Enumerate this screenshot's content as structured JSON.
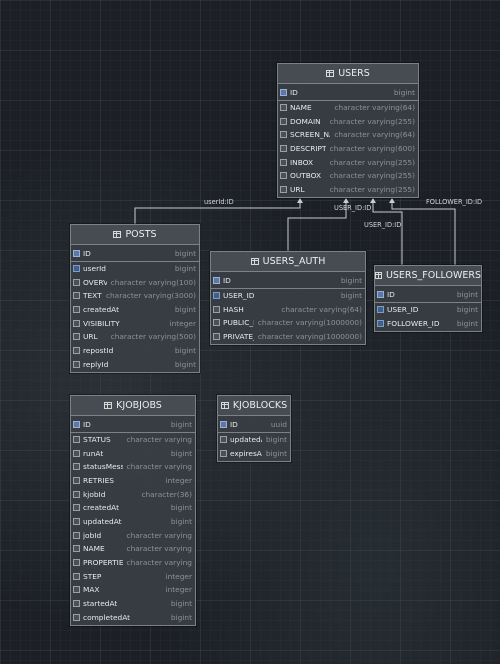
{
  "entities": {
    "users": {
      "name": "USERS",
      "icon": "table-icon",
      "columns": [
        {
          "name": "ID",
          "type": "bigint",
          "icon": "primary-key-icon"
        },
        {
          "name": "NAME",
          "type": "character varying(64)",
          "icon": "column-icon"
        },
        {
          "name": "DOMAIN",
          "type": "character varying(255)",
          "icon": "column-icon"
        },
        {
          "name": "SCREEN_NAME",
          "type": "character varying(64)",
          "icon": "column-icon"
        },
        {
          "name": "DESCRIPTION",
          "type": "character varying(600)",
          "icon": "column-icon"
        },
        {
          "name": "INBOX",
          "type": "character varying(255)",
          "icon": "column-icon"
        },
        {
          "name": "OUTBOX",
          "type": "character varying(255)",
          "icon": "column-icon"
        },
        {
          "name": "URL",
          "type": "character varying(255)",
          "icon": "column-icon"
        }
      ]
    },
    "posts": {
      "name": "POSTS",
      "icon": "table-icon",
      "columns": [
        {
          "name": "ID",
          "type": "bigint",
          "icon": "primary-key-icon"
        },
        {
          "name": "userId",
          "type": "bigint",
          "icon": "foreign-key-icon"
        },
        {
          "name": "OVERVIEW",
          "type": "character varying(100)",
          "icon": "column-icon"
        },
        {
          "name": "TEXT",
          "type": "character varying(3000)",
          "icon": "column-icon"
        },
        {
          "name": "createdAt",
          "type": "bigint",
          "icon": "column-icon"
        },
        {
          "name": "VISIBILITY",
          "type": "integer",
          "icon": "column-icon"
        },
        {
          "name": "URL",
          "type": "character varying(500)",
          "icon": "column-icon"
        },
        {
          "name": "repostId",
          "type": "bigint",
          "icon": "column-icon"
        },
        {
          "name": "replyId",
          "type": "bigint",
          "icon": "column-icon"
        }
      ]
    },
    "users_auth": {
      "name": "USERS_AUTH",
      "icon": "table-icon",
      "columns": [
        {
          "name": "ID",
          "type": "bigint",
          "icon": "primary-key-icon"
        },
        {
          "name": "USER_ID",
          "type": "bigint",
          "icon": "foreign-key-icon"
        },
        {
          "name": "HASH",
          "type": "character varying(64)",
          "icon": "column-icon"
        },
        {
          "name": "PUBLIC_KEY",
          "type": "character varying(1000000)",
          "icon": "column-icon"
        },
        {
          "name": "PRIVATE_KEY",
          "type": "character varying(1000000)",
          "icon": "column-icon"
        }
      ]
    },
    "users_followers": {
      "name": "USERS_FOLLOWERS",
      "icon": "table-icon",
      "columns": [
        {
          "name": "ID",
          "type": "bigint",
          "icon": "primary-key-icon"
        },
        {
          "name": "USER_ID",
          "type": "bigint",
          "icon": "foreign-key-icon"
        },
        {
          "name": "FOLLOWER_ID",
          "type": "bigint",
          "icon": "foreign-key-icon"
        }
      ]
    },
    "kjobjobs": {
      "name": "KJOBJOBS",
      "icon": "table-icon",
      "columns": [
        {
          "name": "ID",
          "type": "bigint",
          "icon": "primary-key-icon"
        },
        {
          "name": "STATUS",
          "type": "character varying",
          "icon": "column-icon"
        },
        {
          "name": "runAt",
          "type": "bigint",
          "icon": "column-icon"
        },
        {
          "name": "statusMessage",
          "type": "character varying",
          "icon": "column-icon"
        },
        {
          "name": "RETRIES",
          "type": "integer",
          "icon": "column-icon"
        },
        {
          "name": "kjobId",
          "type": "character(36)",
          "icon": "column-icon"
        },
        {
          "name": "createdAt",
          "type": "bigint",
          "icon": "column-icon"
        },
        {
          "name": "updatedAt",
          "type": "bigint",
          "icon": "column-icon"
        },
        {
          "name": "jobId",
          "type": "character varying",
          "icon": "column-icon"
        },
        {
          "name": "NAME",
          "type": "character varying",
          "icon": "column-icon"
        },
        {
          "name": "PROPERTIES",
          "type": "character varying",
          "icon": "column-icon"
        },
        {
          "name": "STEP",
          "type": "integer",
          "icon": "column-icon"
        },
        {
          "name": "MAX",
          "type": "integer",
          "icon": "column-icon"
        },
        {
          "name": "startedAt",
          "type": "bigint",
          "icon": "column-icon"
        },
        {
          "name": "completedAt",
          "type": "bigint",
          "icon": "column-icon"
        }
      ]
    },
    "kjoblocks": {
      "name": "KJOBLOCKS",
      "icon": "table-icon",
      "columns": [
        {
          "name": "ID",
          "type": "uuid",
          "icon": "primary-key-icon"
        },
        {
          "name": "updatedAt",
          "type": "bigint",
          "icon": "column-icon"
        },
        {
          "name": "expiresAt",
          "type": "bigint",
          "icon": "column-icon"
        }
      ]
    }
  },
  "relations": [
    {
      "label": "userId:ID",
      "from": "posts",
      "to": "users"
    },
    {
      "label": "USER_ID:ID",
      "from": "users_auth",
      "to": "users"
    },
    {
      "label": "USER_ID:ID",
      "from": "users_followers",
      "to": "users"
    },
    {
      "label": "FOLLOWER_ID:ID",
      "from": "users_followers",
      "to": "users"
    }
  ],
  "colors": {
    "background": "#1c2026",
    "entity_fill": "#3a3e44",
    "entity_border": "#7c8188",
    "column_name": "#e9eaec",
    "column_type": "#8d9298",
    "key_icon": "#5b78a8",
    "edge": "#c9ccd0"
  }
}
